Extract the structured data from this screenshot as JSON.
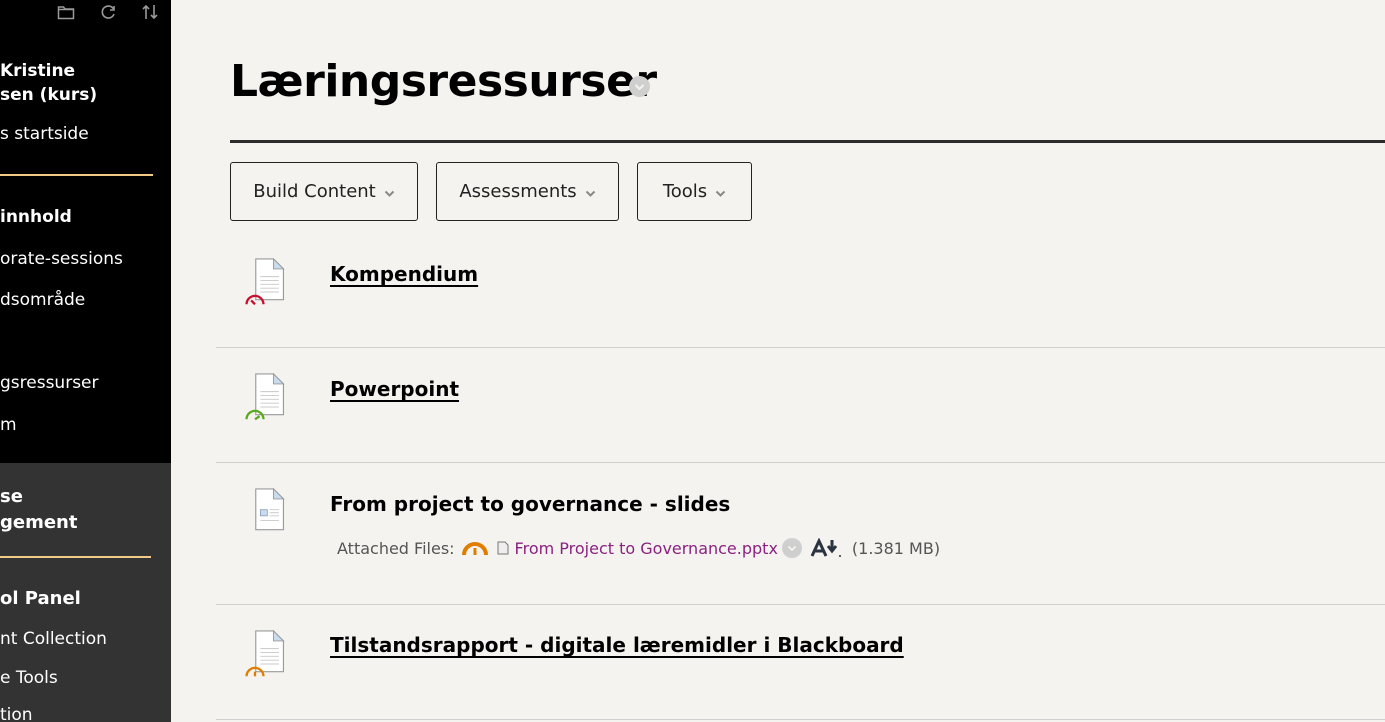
{
  "sidebar": {
    "toolbar_icons": [
      "folder-icon",
      "refresh-icon",
      "sort-icon"
    ],
    "course_name_line1": "Kristine",
    "course_name_line2": "sen (kurs)",
    "home_link": "s startside",
    "section_content": "innhold",
    "items": [
      {
        "label": "orate-sessions"
      },
      {
        "label": "dsområde"
      },
      {
        "label": "gsressurser"
      },
      {
        "label": "m"
      }
    ],
    "management_line1": "se",
    "management_line2": "gement",
    "control_panel": "ol Panel",
    "panel_items": [
      {
        "label": "nt Collection"
      },
      {
        "label": "e Tools"
      },
      {
        "label": "tion"
      }
    ],
    "accent_color": "#f3c987"
  },
  "header": {
    "title": "Læringsressurser"
  },
  "toolbar": {
    "build_content": "Build Content",
    "assessments": "Assessments",
    "tools": "Tools"
  },
  "content_items": [
    {
      "title": "Kompendium",
      "status": "red",
      "linked": true
    },
    {
      "title": "Powerpoint",
      "status": "green",
      "linked": true
    },
    {
      "title": "From project to governance - slides",
      "linked": false,
      "attached_label": "Attached Files:",
      "file_name": "From Project to Governance.pptx",
      "file_size": "(1.381 MB)",
      "status": "orange"
    },
    {
      "title": "Tilstandsrapport - digitale læremidler i Blackboard",
      "status": "orange",
      "linked": true
    }
  ],
  "colors": {
    "status_red": "#c8102e",
    "status_green": "#5aaa1e",
    "status_orange": "#e07c00",
    "link_purple": "#8b2281"
  }
}
